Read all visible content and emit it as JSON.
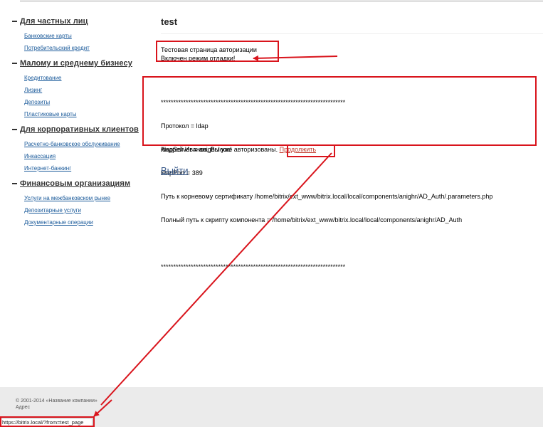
{
  "sidebar": {
    "sections": [
      {
        "title": "Для частных лиц",
        "items": [
          "Банковские карты",
          "Потребительский кредит"
        ]
      },
      {
        "title": "Малому и среднему бизнесу",
        "items": [
          "Кредитование",
          "Лизинг",
          "Депозиты",
          "Пластиковые карты"
        ]
      },
      {
        "title": "Для корпоративных клиентов",
        "items": [
          "Расчетно-банковское обслуживание",
          "Инкассация",
          "Интернет-банкинг"
        ]
      },
      {
        "title": "Финансовым организациям",
        "items": [
          "Услуги на межбанковском рынке",
          "Депозитарные услуги",
          "Документарные операции"
        ]
      }
    ]
  },
  "content": {
    "title": "test",
    "message_line1": "Тестовая страница авторизации",
    "message_line2": "Включен режим отладки!",
    "separator": "**************************************************************************",
    "protocol_line": "Протокол = ldap",
    "server_line": "ldapServer = anighr.local",
    "port_line": "ldapPort = 389",
    "cert_path_line": "Путь к корневому сертификату /home/bitrix/ext_www/bitrix.local/local/components/anighr/AD_Auth/.parameters.php",
    "script_path_line": "Полный путь к скрипту компонента = /home/bitrix/ext_www/bitrix.local/local/components/anighr/AD_Auth",
    "auth_text": "Андрей Иванов, Вы уже авторизованы.",
    "continue_link": "Продолжить",
    "logout_link": "Выйти"
  },
  "footer": {
    "copyright": "© 2001-2014 «Название компании»",
    "address": "Адрес"
  },
  "status_bar": {
    "url": "https://bitrix.local/?from=test_page"
  },
  "colors": {
    "annotation_red": "#d9141c",
    "link_blue": "#1a5a9a",
    "footer_gray": "#ebebeb"
  }
}
